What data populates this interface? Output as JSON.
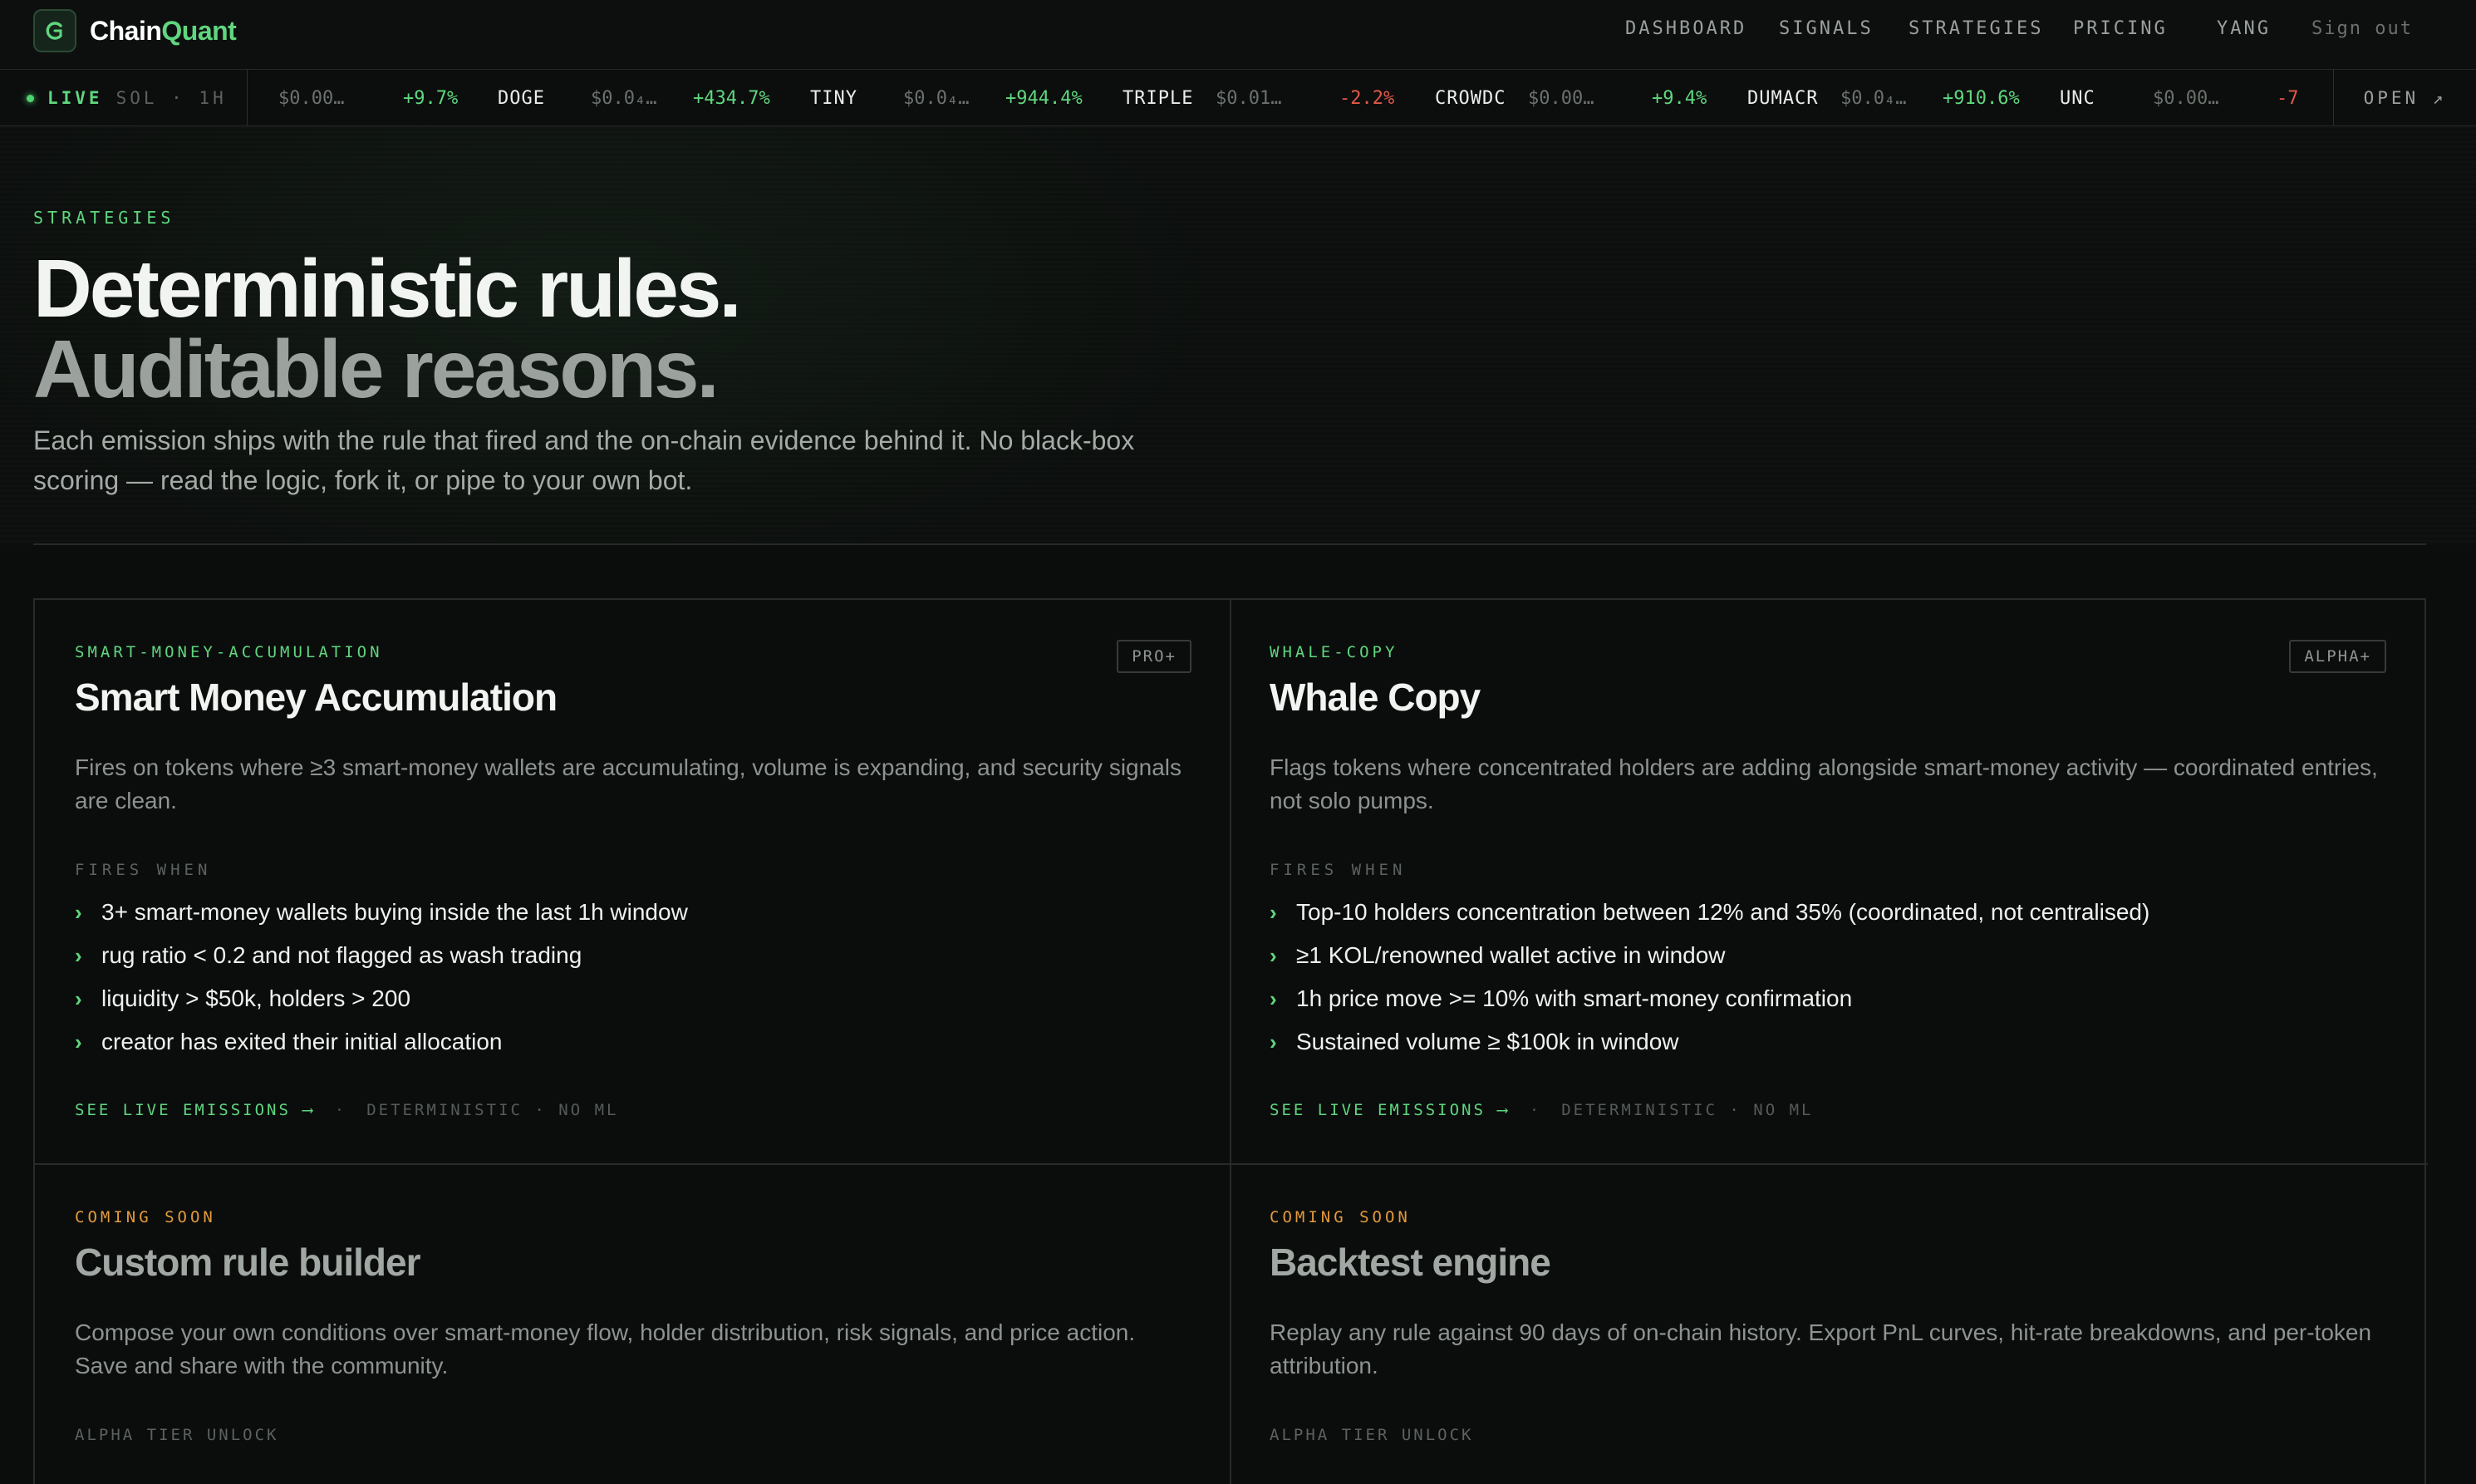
{
  "brand": {
    "name_a": "Chain",
    "name_b": "Quant"
  },
  "nav": {
    "links": [
      "DASHBOARD",
      "SIGNALS",
      "STRATEGIES",
      "PRICING"
    ],
    "user": "YANG",
    "signout": "Sign out"
  },
  "ticker": {
    "live_label": "LIVE",
    "meta": "SOL · 1H",
    "open_label": "OPEN ↗",
    "items": [
      {
        "symbol": "",
        "price": "$0.00…",
        "change": "+9.7%",
        "dir": "up"
      },
      {
        "symbol": "DOGE",
        "price": "$0.0₄…",
        "change": "+434.7%",
        "dir": "up"
      },
      {
        "symbol": "TINY",
        "price": "$0.0₄…",
        "change": "+944.4%",
        "dir": "up"
      },
      {
        "symbol": "TRIPLE",
        "price": "$0.01…",
        "change": "-2.2%",
        "dir": "down"
      },
      {
        "symbol": "CROWDC",
        "price": "$0.00…",
        "change": "+9.4%",
        "dir": "up"
      },
      {
        "symbol": "DUMACR",
        "price": "$0.0₄…",
        "change": "+910.6%",
        "dir": "up"
      },
      {
        "symbol": "UNC",
        "price": "$0.00…",
        "change": "-7",
        "dir": "down"
      }
    ]
  },
  "hero": {
    "eyebrow": "STRATEGIES",
    "title_line1": "Deterministic rules.",
    "title_line2": "Auditable reasons.",
    "lead": "Each emission ships with the rule that fired and the on-chain evidence behind it. No black-box scoring — read the logic, fork it, or pipe to your own bot."
  },
  "strategies": [
    {
      "slug": "SMART-MONEY-ACCUMULATION",
      "tier": "PRO+",
      "title": "Smart Money Accumulation",
      "description": "Fires on tokens where ≥3 smart-money wallets are accumulating, volume is expanding, and security signals are clean.",
      "fires_label": "FIRES WHEN",
      "rules": [
        "3+ smart-money wallets buying inside the last 1h window",
        "rug ratio < 0.2 and not flagged as wash trading",
        "liquidity > $50k, holders > 200",
        "creator has exited their initial allocation"
      ],
      "cta": "SEE LIVE EMISSIONS ⟶",
      "note": "DETERMINISTIC · NO ML"
    },
    {
      "slug": "WHALE-COPY",
      "tier": "ALPHA+",
      "title": "Whale Copy",
      "description": "Flags tokens where concentrated holders are adding alongside smart-money activity — coordinated entries, not solo pumps.",
      "fires_label": "FIRES WHEN",
      "rules": [
        "Top-10 holders concentration between 12% and 35% (coordinated, not centralised)",
        "≥1 KOL/renowned wallet active in window",
        "1h price move >= 10% with smart-money confirmation",
        "Sustained volume ≥ $100k in window"
      ],
      "cta": "SEE LIVE EMISSIONS ⟶",
      "note": "DETERMINISTIC · NO ML"
    }
  ],
  "coming_soon": [
    {
      "label": "COMING SOON",
      "title": "Custom rule builder",
      "description": "Compose your own conditions over smart-money flow, holder distribution, risk signals, and price action. Save and share with the community.",
      "unlock": "ALPHA TIER UNLOCK"
    },
    {
      "label": "COMING SOON",
      "title": "Backtest engine",
      "description": "Replay any rule against 90 days of on-chain history. Export PnL curves, hit-rate breakdowns, and per-token attribution.",
      "unlock": "ALPHA TIER UNLOCK"
    }
  ],
  "colors": {
    "background": "#0b0d0c",
    "accent": "#5fd67f",
    "negative": "#e0584a",
    "coming_soon": "#e39a3b"
  }
}
